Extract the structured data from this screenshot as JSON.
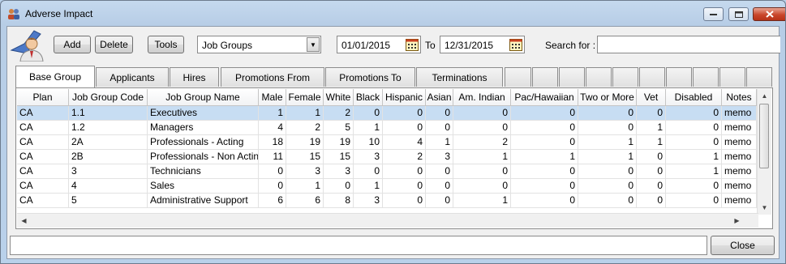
{
  "window": {
    "title": "Adverse Impact"
  },
  "toolbar": {
    "add_label": "Add",
    "delete_label": "Delete",
    "tools_label": "Tools",
    "group_select": "Job Groups",
    "date_from": "01/01/2015",
    "to_label": "To",
    "date_to": "12/31/2015",
    "search_label": "Search for :",
    "search_value": ""
  },
  "tabs": [
    "Base Group",
    "Applicants",
    "Hires",
    "Promotions From",
    "Promotions To",
    "Terminations"
  ],
  "grid": {
    "columns": [
      "Plan",
      "Job Group Code",
      "Job Group Name",
      "Male",
      "Female",
      "White",
      "Black",
      "Hispanic",
      "Asian",
      "Am. Indian",
      "Pac/Hawaiian",
      "Two or More",
      "Vet",
      "Disabled",
      "Notes"
    ],
    "rows": [
      [
        "CA",
        "1.1",
        "Executives",
        "1",
        "1",
        "2",
        "0",
        "0",
        "0",
        "0",
        "0",
        "0",
        "0",
        "0",
        "memo"
      ],
      [
        "CA",
        "1.2",
        "Managers",
        "4",
        "2",
        "5",
        "1",
        "0",
        "0",
        "0",
        "0",
        "0",
        "1",
        "0",
        "memo"
      ],
      [
        "CA",
        "2A",
        "Professionals - Acting",
        "18",
        "19",
        "19",
        "10",
        "4",
        "1",
        "2",
        "0",
        "1",
        "1",
        "0",
        "memo"
      ],
      [
        "CA",
        "2B",
        "Professionals - Non Acting",
        "11",
        "15",
        "15",
        "3",
        "2",
        "3",
        "1",
        "1",
        "1",
        "0",
        "1",
        "memo"
      ],
      [
        "CA",
        "3",
        "Technicians",
        "0",
        "3",
        "3",
        "0",
        "0",
        "0",
        "0",
        "0",
        "0",
        "0",
        "1",
        "memo"
      ],
      [
        "CA",
        "4",
        "Sales",
        "0",
        "1",
        "0",
        "1",
        "0",
        "0",
        "0",
        "0",
        "0",
        "0",
        "0",
        "memo"
      ],
      [
        "CA",
        "5",
        "Administrative Support",
        "6",
        "6",
        "8",
        "3",
        "0",
        "0",
        "1",
        "0",
        "0",
        "0",
        "0",
        "memo"
      ]
    ]
  },
  "footer": {
    "status_text": "",
    "close_label": "Close"
  }
}
